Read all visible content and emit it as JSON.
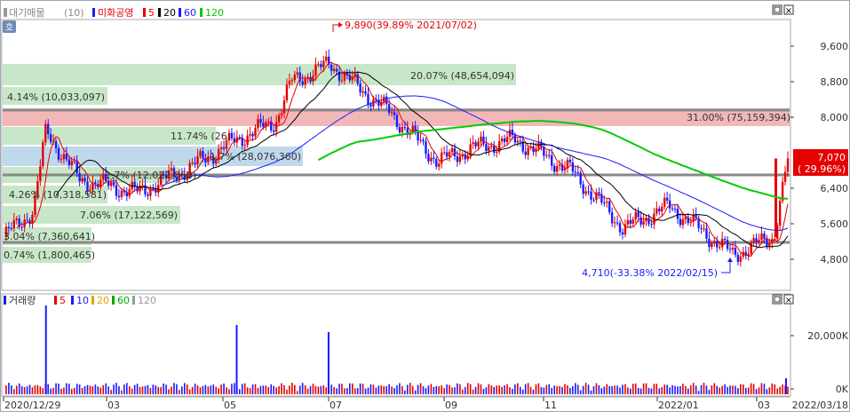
{
  "price_panel": {
    "legend": {
      "indicator": "대기매물",
      "indicator_param": "(10)",
      "stock_name": "미화공영",
      "ma_periods": [
        "5",
        "20",
        "60",
        "120"
      ],
      "ma_colors": [
        "#e60000",
        "#000000",
        "#1a1aff",
        "#00cc00"
      ]
    },
    "high_annotation": "9,890(39.89% 2021/07/02)",
    "low_annotation": "4,710(-33.38% 2022/02/15)",
    "current_price": "7,070",
    "current_change": "( 29.96%)",
    "y_tick_labels": [
      "9,600",
      "8,800",
      "8,000",
      "7,200",
      "6,400",
      "5,600",
      "4,800"
    ],
    "overhang_labels": [
      "20.07% (48,654,094)",
      "4.14% (10,033,097)",
      "31.00% (75,159,394)",
      "11.74% (26,",
      "1.7% (28,076,360)",
      "1.7% (12,022,068)",
      "4.26% (10,318,581)",
      "7.06% (17,122,569)",
      "3.04% (7,360,641)",
      "0.74% (1,800,465)"
    ]
  },
  "volume_panel": {
    "legend": {
      "indicator": "거래량",
      "ma_periods": [
        "5",
        "10",
        "20",
        "60",
        "120"
      ],
      "ma_colors": [
        "#e60000",
        "#1a1aff",
        "#e6a000",
        "#00aa00",
        "#999999"
      ]
    },
    "y_tick_labels": [
      "20,000K",
      "0K"
    ]
  },
  "x_axis": {
    "tick_labels": [
      "2020/12/29",
      "03",
      "05",
      "07",
      "09",
      "11",
      "2022/01",
      "03"
    ],
    "end_label": "2022/03/18"
  },
  "buttons": {
    "close": "×",
    "maximize": "□",
    "side_tab": "호"
  },
  "colors": {
    "up": "#e60000",
    "down": "#1a1aff",
    "green_band": "#c8e6c8",
    "red_band": "#f2b8b8",
    "blue_band": "#c0d8ec",
    "ma120": "#00cc00"
  },
  "chart_data": [
    {
      "type": "candlestick",
      "title": "미화공영",
      "x_range": [
        "2020/12/29",
        "2022/03/18"
      ],
      "y_range": [
        4400,
        10000
      ],
      "high": {
        "value": 9890,
        "pct": 39.89,
        "date": "2021/07/02"
      },
      "low": {
        "value": 4710,
        "pct": -33.38,
        "date": "2022/02/15"
      },
      "last": {
        "value": 7070,
        "pct": 29.96,
        "date": "2022/03/18"
      },
      "support_lines": [
        8000,
        6660,
        5180
      ],
      "ohlc_sample": [
        {
          "date": "2020/12/29",
          "close": 5300
        },
        {
          "date": "2021/01/15",
          "close": 5900
        },
        {
          "date": "2021/01/22",
          "close": 7700
        },
        {
          "date": "2021/02/10",
          "close": 6600
        },
        {
          "date": "2021/03/15",
          "close": 6300
        },
        {
          "date": "2021/04/15",
          "close": 6900
        },
        {
          "date": "2021/05/10",
          "close": 7500
        },
        {
          "date": "2021/06/01",
          "close": 7900
        },
        {
          "date": "2021/06/10",
          "close": 8800
        },
        {
          "date": "2021/07/02",
          "close": 9200
        },
        {
          "date": "2021/07/20",
          "close": 8600
        },
        {
          "date": "2021/08/05",
          "close": 8100
        },
        {
          "date": "2021/09/01",
          "close": 7000
        },
        {
          "date": "2021/09/20",
          "close": 7300
        },
        {
          "date": "2021/10/15",
          "close": 7500
        },
        {
          "date": "2021/11/15",
          "close": 6800
        },
        {
          "date": "2021/12/15",
          "close": 5500
        },
        {
          "date": "2022/01/10",
          "close": 6000
        },
        {
          "date": "2022/02/15",
          "close": 4900
        },
        {
          "date": "2022/03/10",
          "close": 5300
        },
        {
          "date": "2022/03/18",
          "close": 7070
        }
      ],
      "moving_averages": [
        {
          "name": "5",
          "color": "#e60000"
        },
        {
          "name": "20",
          "color": "#000000"
        },
        {
          "name": "60",
          "color": "#1a1aff"
        },
        {
          "name": "120",
          "color": "#00cc00"
        }
      ]
    },
    {
      "type": "bar",
      "title": "거래량",
      "y_range": [
        "0K",
        "20,000K"
      ],
      "volume_spikes": [
        {
          "date": "2021/01/22",
          "level": "very high"
        },
        {
          "date": "2021/05/10",
          "level": "high"
        },
        {
          "date": "2021/07/01",
          "level": "medium"
        },
        {
          "date": "2022/03/18",
          "level": "low"
        }
      ]
    }
  ]
}
